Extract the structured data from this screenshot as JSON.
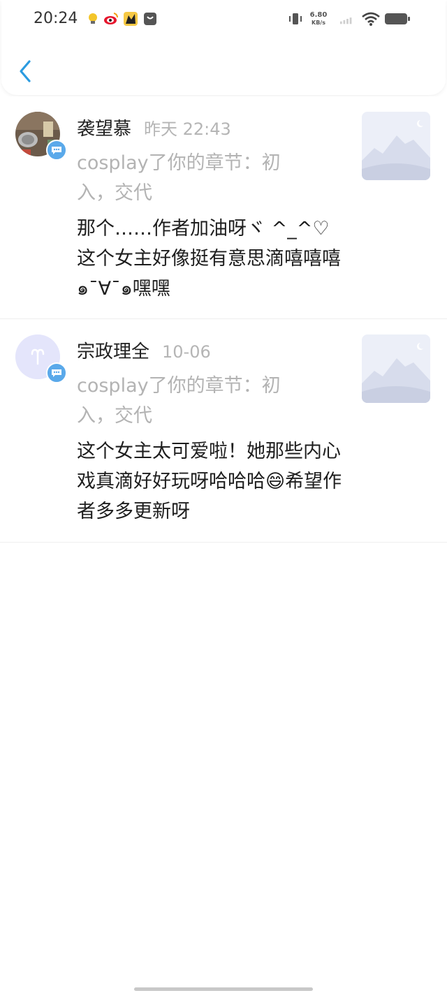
{
  "status_bar": {
    "time": "20:24",
    "net_speed_value": "6.80",
    "net_speed_unit": "KB/s",
    "icons": [
      "lightbulb-icon",
      "weibo-icon",
      "cat-app-icon",
      "shopping-bag-icon",
      "vibrate-icon",
      "signal-icon",
      "wifi-icon",
      "battery-icon"
    ]
  },
  "header": {
    "back_icon": "chevron-left-icon",
    "accent": "#2b9be0"
  },
  "feed": [
    {
      "username": "袭望慕",
      "time": "昨天 22:43",
      "action": "cosplay了你的章节：初入，交代",
      "content": "那个……作者加油呀ヾ ^_^♡这个女主好像挺有意思滴嘻嘻嘻๑¯∀¯๑嘿嘿"
    },
    {
      "username": "宗政理全",
      "time": "10-06",
      "action": "cosplay了你的章节：初入，交代",
      "content": "这个女主太可爱啦！她那些内心戏真滴好好玩呀哈哈哈😄希望作者多多更新呀"
    }
  ]
}
